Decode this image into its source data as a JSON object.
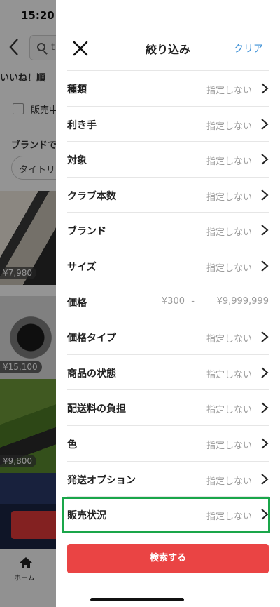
{
  "status_bar": {
    "time": "15:20"
  },
  "background": {
    "search_text": "t",
    "sort_label": "いいね！順",
    "checkbox_label": "販売中",
    "brand_label": "ブランドで絞",
    "chip_label": "タイトリ",
    "prices": [
      "¥7,980",
      "¥15,100",
      "¥9,800"
    ],
    "tab_home_label": "ホーム"
  },
  "panel": {
    "title": "絞り込み",
    "clear_label": "クリア",
    "filters": [
      {
        "label": "種類",
        "value": "指定しない"
      },
      {
        "label": "利き手",
        "value": "指定しない"
      },
      {
        "label": "対象",
        "value": "指定しない"
      },
      {
        "label": "クラブ本数",
        "value": "指定しない"
      },
      {
        "label": "ブランド",
        "value": "指定しない"
      },
      {
        "label": "サイズ",
        "value": "指定しない"
      },
      {
        "label": "価格",
        "min": "¥300",
        "separator": "-",
        "max": "¥9,999,999"
      },
      {
        "label": "価格タイプ",
        "value": "指定しない"
      },
      {
        "label": "商品の状態",
        "value": "指定しない"
      },
      {
        "label": "配送料の負担",
        "value": "指定しない"
      },
      {
        "label": "色",
        "value": "指定しない"
      },
      {
        "label": "発送オプション",
        "value": "指定しない"
      },
      {
        "label": "販売状況",
        "value": "指定しない"
      }
    ],
    "search_button_label": "検索する"
  },
  "colors": {
    "accent_red": "#ea4444",
    "link_blue": "#3b8fd6",
    "highlight_green": "#1aa64a"
  }
}
